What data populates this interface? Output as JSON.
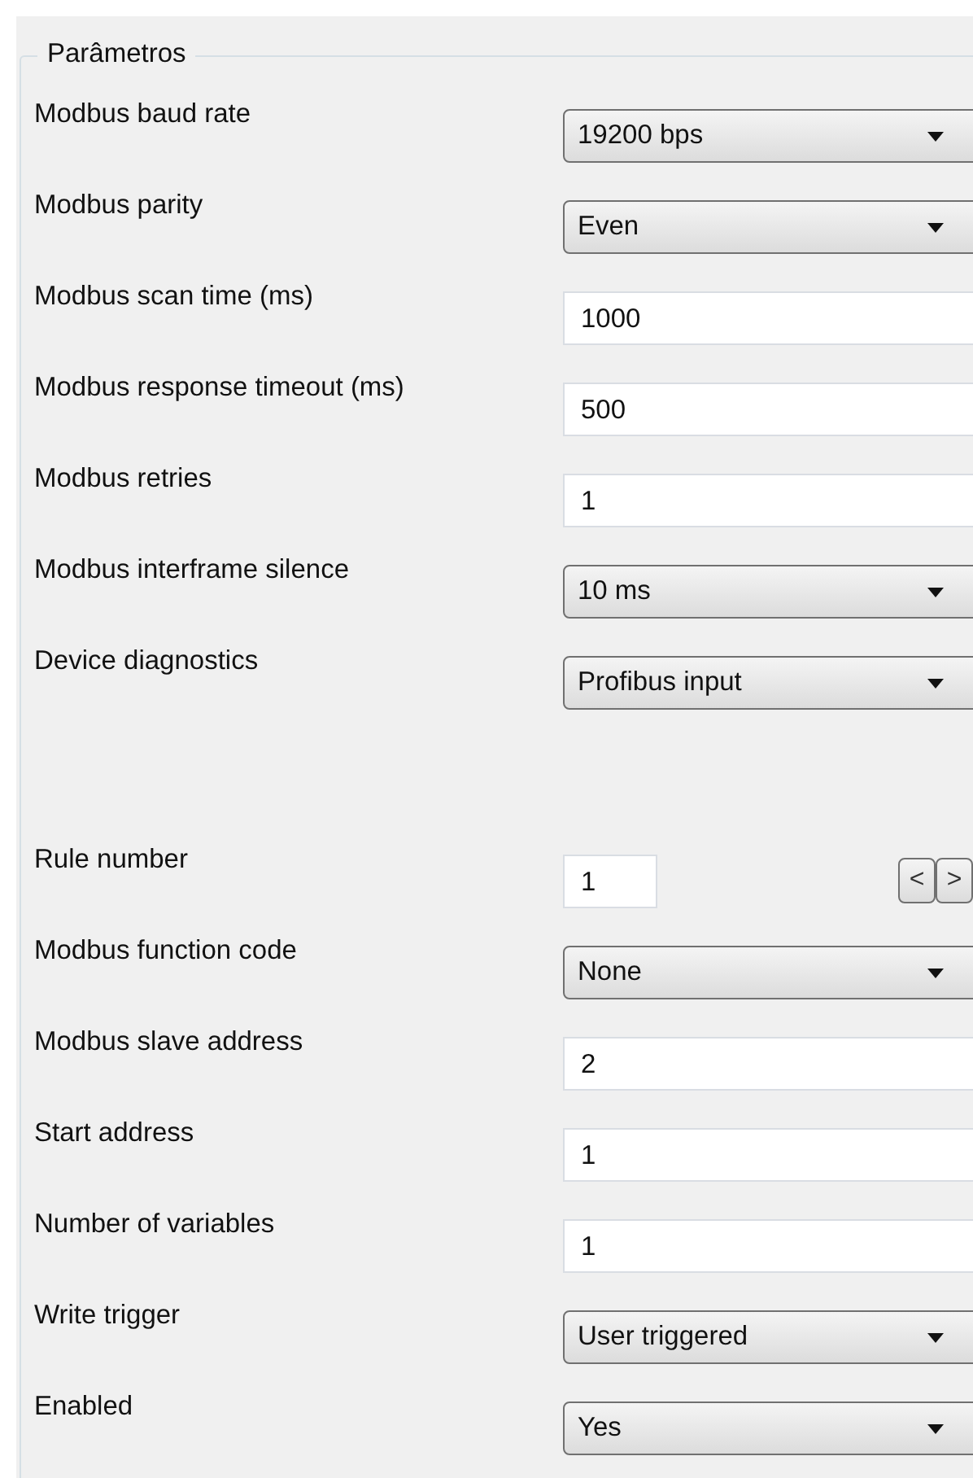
{
  "group": {
    "title": "Parâmetros"
  },
  "sections": [
    {
      "fields": [
        {
          "label": "Modbus baud rate",
          "kind": "dropdown",
          "value": "19200 bps"
        },
        {
          "label": "Modbus parity",
          "kind": "dropdown",
          "value": "Even"
        },
        {
          "label": "Modbus scan time (ms)",
          "kind": "input",
          "value": "1000"
        },
        {
          "label": "Modbus response timeout (ms)",
          "kind": "input",
          "value": "500"
        },
        {
          "label": "Modbus retries",
          "kind": "input",
          "value": "1"
        },
        {
          "label": "Modbus interframe silence",
          "kind": "dropdown",
          "value": "10 ms"
        },
        {
          "label": "Device diagnostics",
          "kind": "dropdown",
          "value": "Profibus input"
        }
      ]
    },
    {
      "fields": [
        {
          "label": "Rule number",
          "kind": "stepper",
          "value": "1",
          "prev": "<",
          "next": ">"
        },
        {
          "label": "Modbus function code",
          "kind": "dropdown",
          "value": "None"
        },
        {
          "label": "Modbus slave address",
          "kind": "input",
          "value": "2"
        },
        {
          "label": "Start address",
          "kind": "input",
          "value": "1"
        },
        {
          "label": "Number of variables",
          "kind": "input",
          "value": "1"
        },
        {
          "label": "Write trigger",
          "kind": "dropdown",
          "value": "User triggered"
        },
        {
          "label": "Enabled",
          "kind": "dropdown",
          "value": "Yes"
        }
      ]
    }
  ]
}
